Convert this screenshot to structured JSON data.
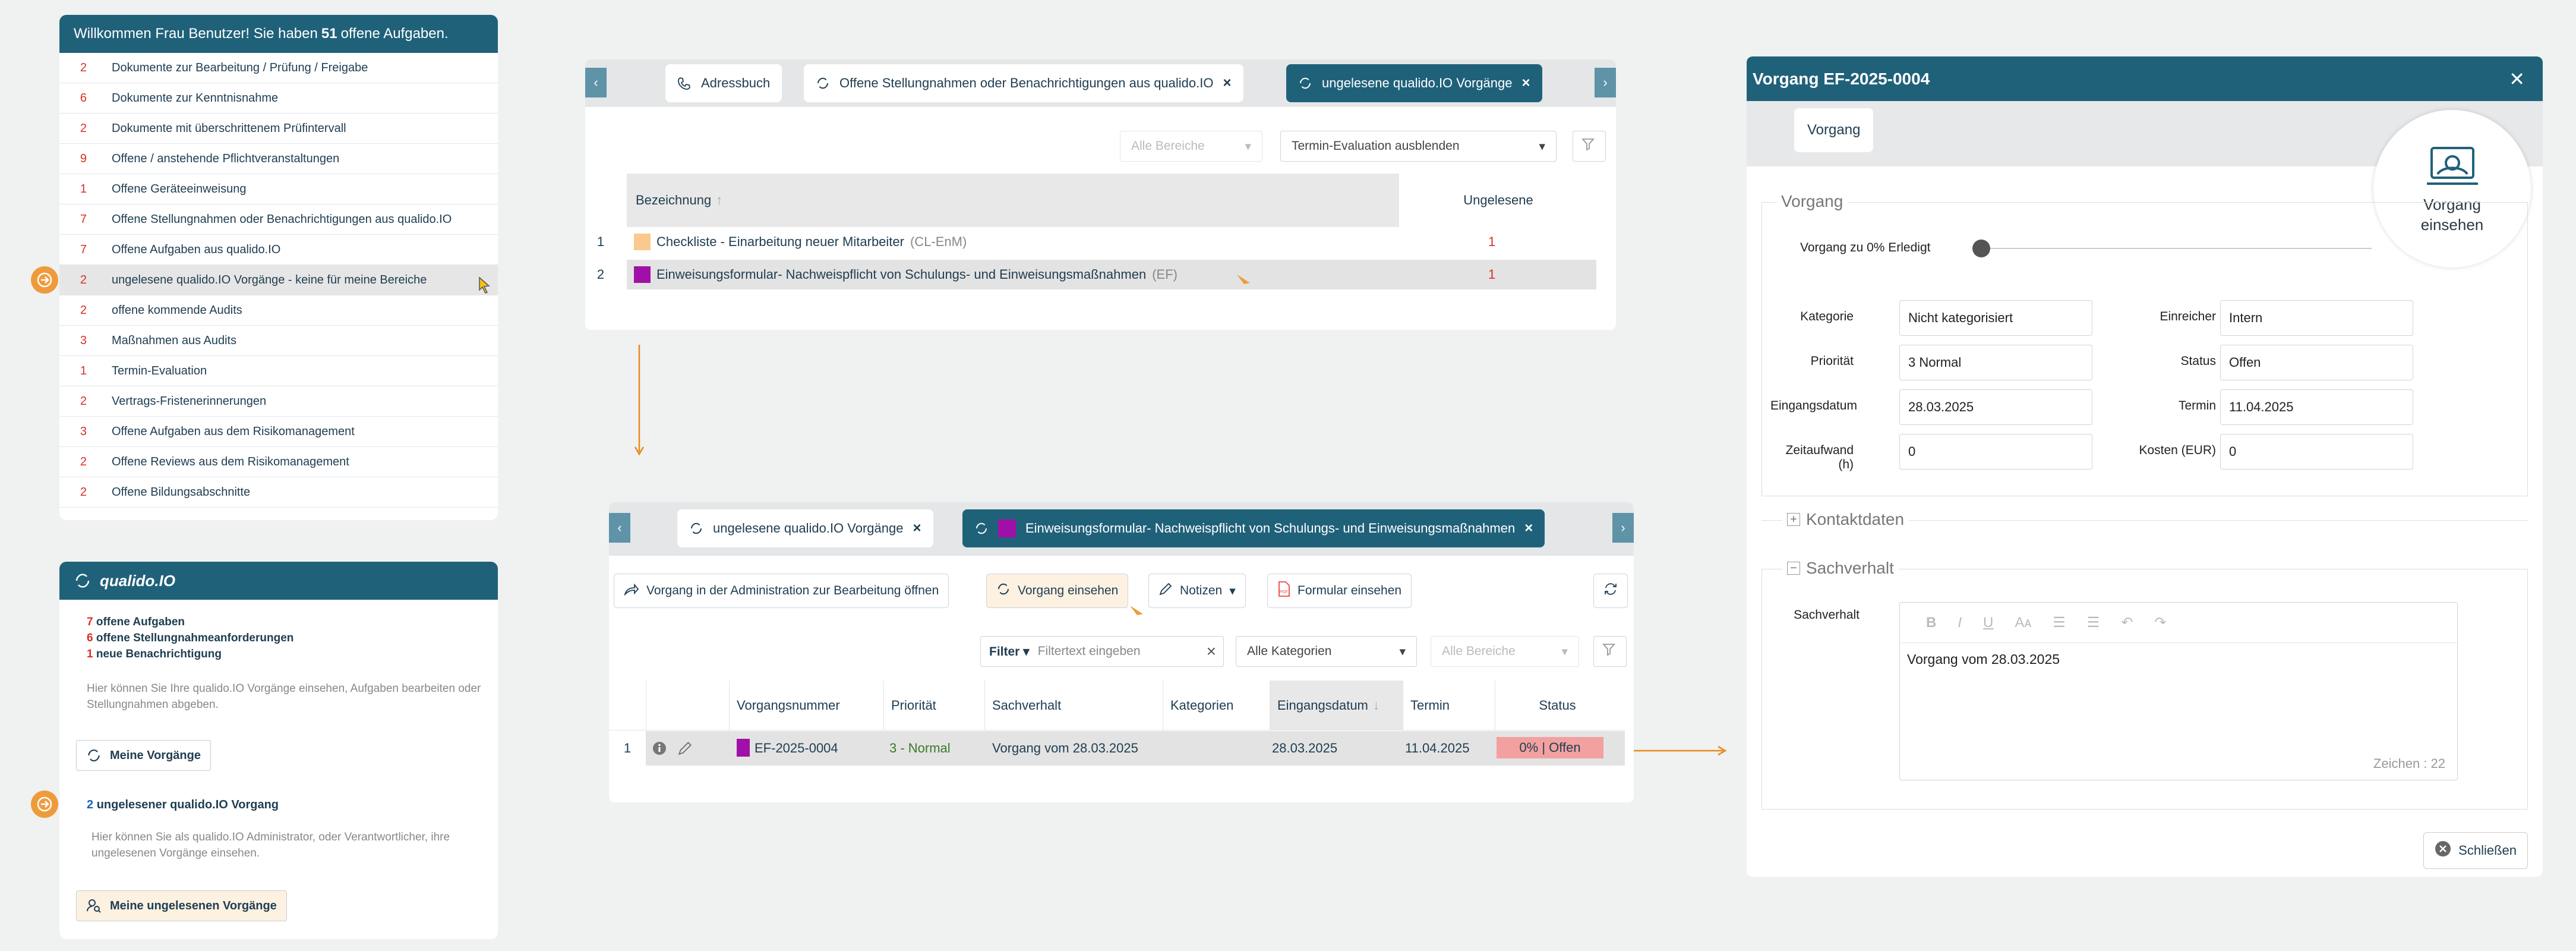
{
  "welcome": {
    "prefix": "Willkommen Frau Benutzer! Sie haben",
    "count": "51",
    "suffix": "offene Aufgaben.",
    "tasks": [
      {
        "count": "2",
        "label": "Dokumente zur Bearbeitung / Prüfung / Freigabe"
      },
      {
        "count": "6",
        "label": "Dokumente zur Kenntnisnahme"
      },
      {
        "count": "2",
        "label": "Dokumente mit überschrittenem Prüfintervall"
      },
      {
        "count": "9",
        "label": "Offene / anstehende Pflichtveranstaltungen"
      },
      {
        "count": "1",
        "label": "Offene Geräteeinweisung"
      },
      {
        "count": "7",
        "label": "Offene Stellungnahmen oder Benachrichtigungen aus qualido.IO"
      },
      {
        "count": "7",
        "label": "Offene Aufgaben aus qualido.IO"
      },
      {
        "count": "2",
        "label": "ungelesene qualido.IO Vorgänge - keine für meine Bereiche"
      },
      {
        "count": "2",
        "label": "offene kommende Audits"
      },
      {
        "count": "3",
        "label": "Maßnahmen aus Audits"
      },
      {
        "count": "1",
        "label": "Termin-Evaluation"
      },
      {
        "count": "2",
        "label": "Vertrags-Fristenerinnerungen"
      },
      {
        "count": "3",
        "label": "Offene Aufgaben aus dem Risikomanagement"
      },
      {
        "count": "2",
        "label": "Offene Reviews aus dem Risikomanagement"
      },
      {
        "count": "2",
        "label": "Offene Bildungsabschnitte"
      }
    ]
  },
  "qualido": {
    "title": "qualido.IO",
    "stats": [
      {
        "count": "7",
        "label": "offene Aufgaben"
      },
      {
        "count": "6",
        "label": "offene Stellungnahmeanforderungen"
      },
      {
        "count": "1",
        "label": "neue Benachrichtigung"
      }
    ],
    "desc1": "Hier können Sie Ihre qualido.IO Vorgänge einsehen, Aufgaben bearbeiten oder Stellungnahmen abgeben.",
    "btn1": "Meine Vorgänge",
    "unread_count": "2",
    "unread_label": "ungelesener qualido.IO Vorgang",
    "desc2": "Hier können Sie als qualido.IO Administrator, oder Verantwortlicher, ihre ungelesenen Vorgänge einsehen.",
    "btn2": "Meine ungelesenen Vorgänge"
  },
  "list_view": {
    "tabs": [
      "Adressbuch",
      "Offene Stellungnahmen oder Benachrichtigungen aus qualido.IO",
      "ungelesene qualido.IO Vorgänge"
    ],
    "filter1": "Alle Bereiche",
    "filter2": "Termin-Evaluation ausblenden",
    "col1": "Bezeichnung",
    "col2": "Ungelesene",
    "rows": [
      {
        "n": "1",
        "name": "Checkliste - Einarbeitung neuer Mitarbeiter",
        "code": "(CL-EnM)",
        "unread": "1",
        "color": "#f9c98e"
      },
      {
        "n": "2",
        "name": "Einweisungsformular- Nachweispflicht von Schulungs- und Einweisungsmaßnahmen",
        "code": "(EF)",
        "unread": "1",
        "color": "#a010a8"
      }
    ]
  },
  "detail_view": {
    "tabs": [
      "ungelesene qualido.IO Vorgänge",
      "Einweisungsformular- Nachweispflicht von Schulungs- und Einweisungsmaßnahmen"
    ],
    "toolbar": {
      "open_admin": "Vorgang in der Administration zur Bearbeitung öffnen",
      "view": "Vorgang einsehen",
      "notes": "Notizen",
      "form": "Formular einsehen"
    },
    "filter_label": "Filter",
    "filter_placeholder": "Filtertext eingeben",
    "categories": "Alle Kategorien",
    "areas": "Alle Bereiche",
    "columns": [
      "Vorgangsnummer",
      "Priorität",
      "Sachverhalt",
      "Kategorien",
      "Eingangsdatum",
      "Termin",
      "Status"
    ],
    "row": {
      "n": "1",
      "number": "EF-2025-0004",
      "priority": "3 - Normal",
      "subject": "Vorgang vom 28.03.2025",
      "category": "",
      "received": "28.03.2025",
      "due": "11.04.2025",
      "status": "0% | Offen"
    }
  },
  "dialog": {
    "title": "Vorgang EF-2025-0004",
    "tab": "Vorgang",
    "badge": "Vorgang einsehen",
    "section": "Vorgang",
    "progress_label": "Vorgang zu 0% Erledigt",
    "progress_percent": 0,
    "fields_left": [
      {
        "label": "Kategorie",
        "value": "Nicht kategorisiert"
      },
      {
        "label": "Priorität",
        "value": "3 Normal"
      },
      {
        "label": "Eingangsdatum",
        "value": "28.03.2025"
      },
      {
        "label": "Zeitaufwand (h)",
        "value": "0"
      }
    ],
    "fields_right": [
      {
        "label": "Einreicher",
        "value": "Intern"
      },
      {
        "label": "Status",
        "value": "Offen"
      },
      {
        "label": "Termin",
        "value": "11.04.2025"
      },
      {
        "label": "Kosten (EUR)",
        "value": "0"
      }
    ],
    "contacts": "Kontaktdaten",
    "facts": "Sachverhalt",
    "facts_label": "Sachverhalt",
    "facts_text": "Vorgang vom 28.03.2025",
    "chars": "Zeichen : 22",
    "close": "Schließen"
  }
}
